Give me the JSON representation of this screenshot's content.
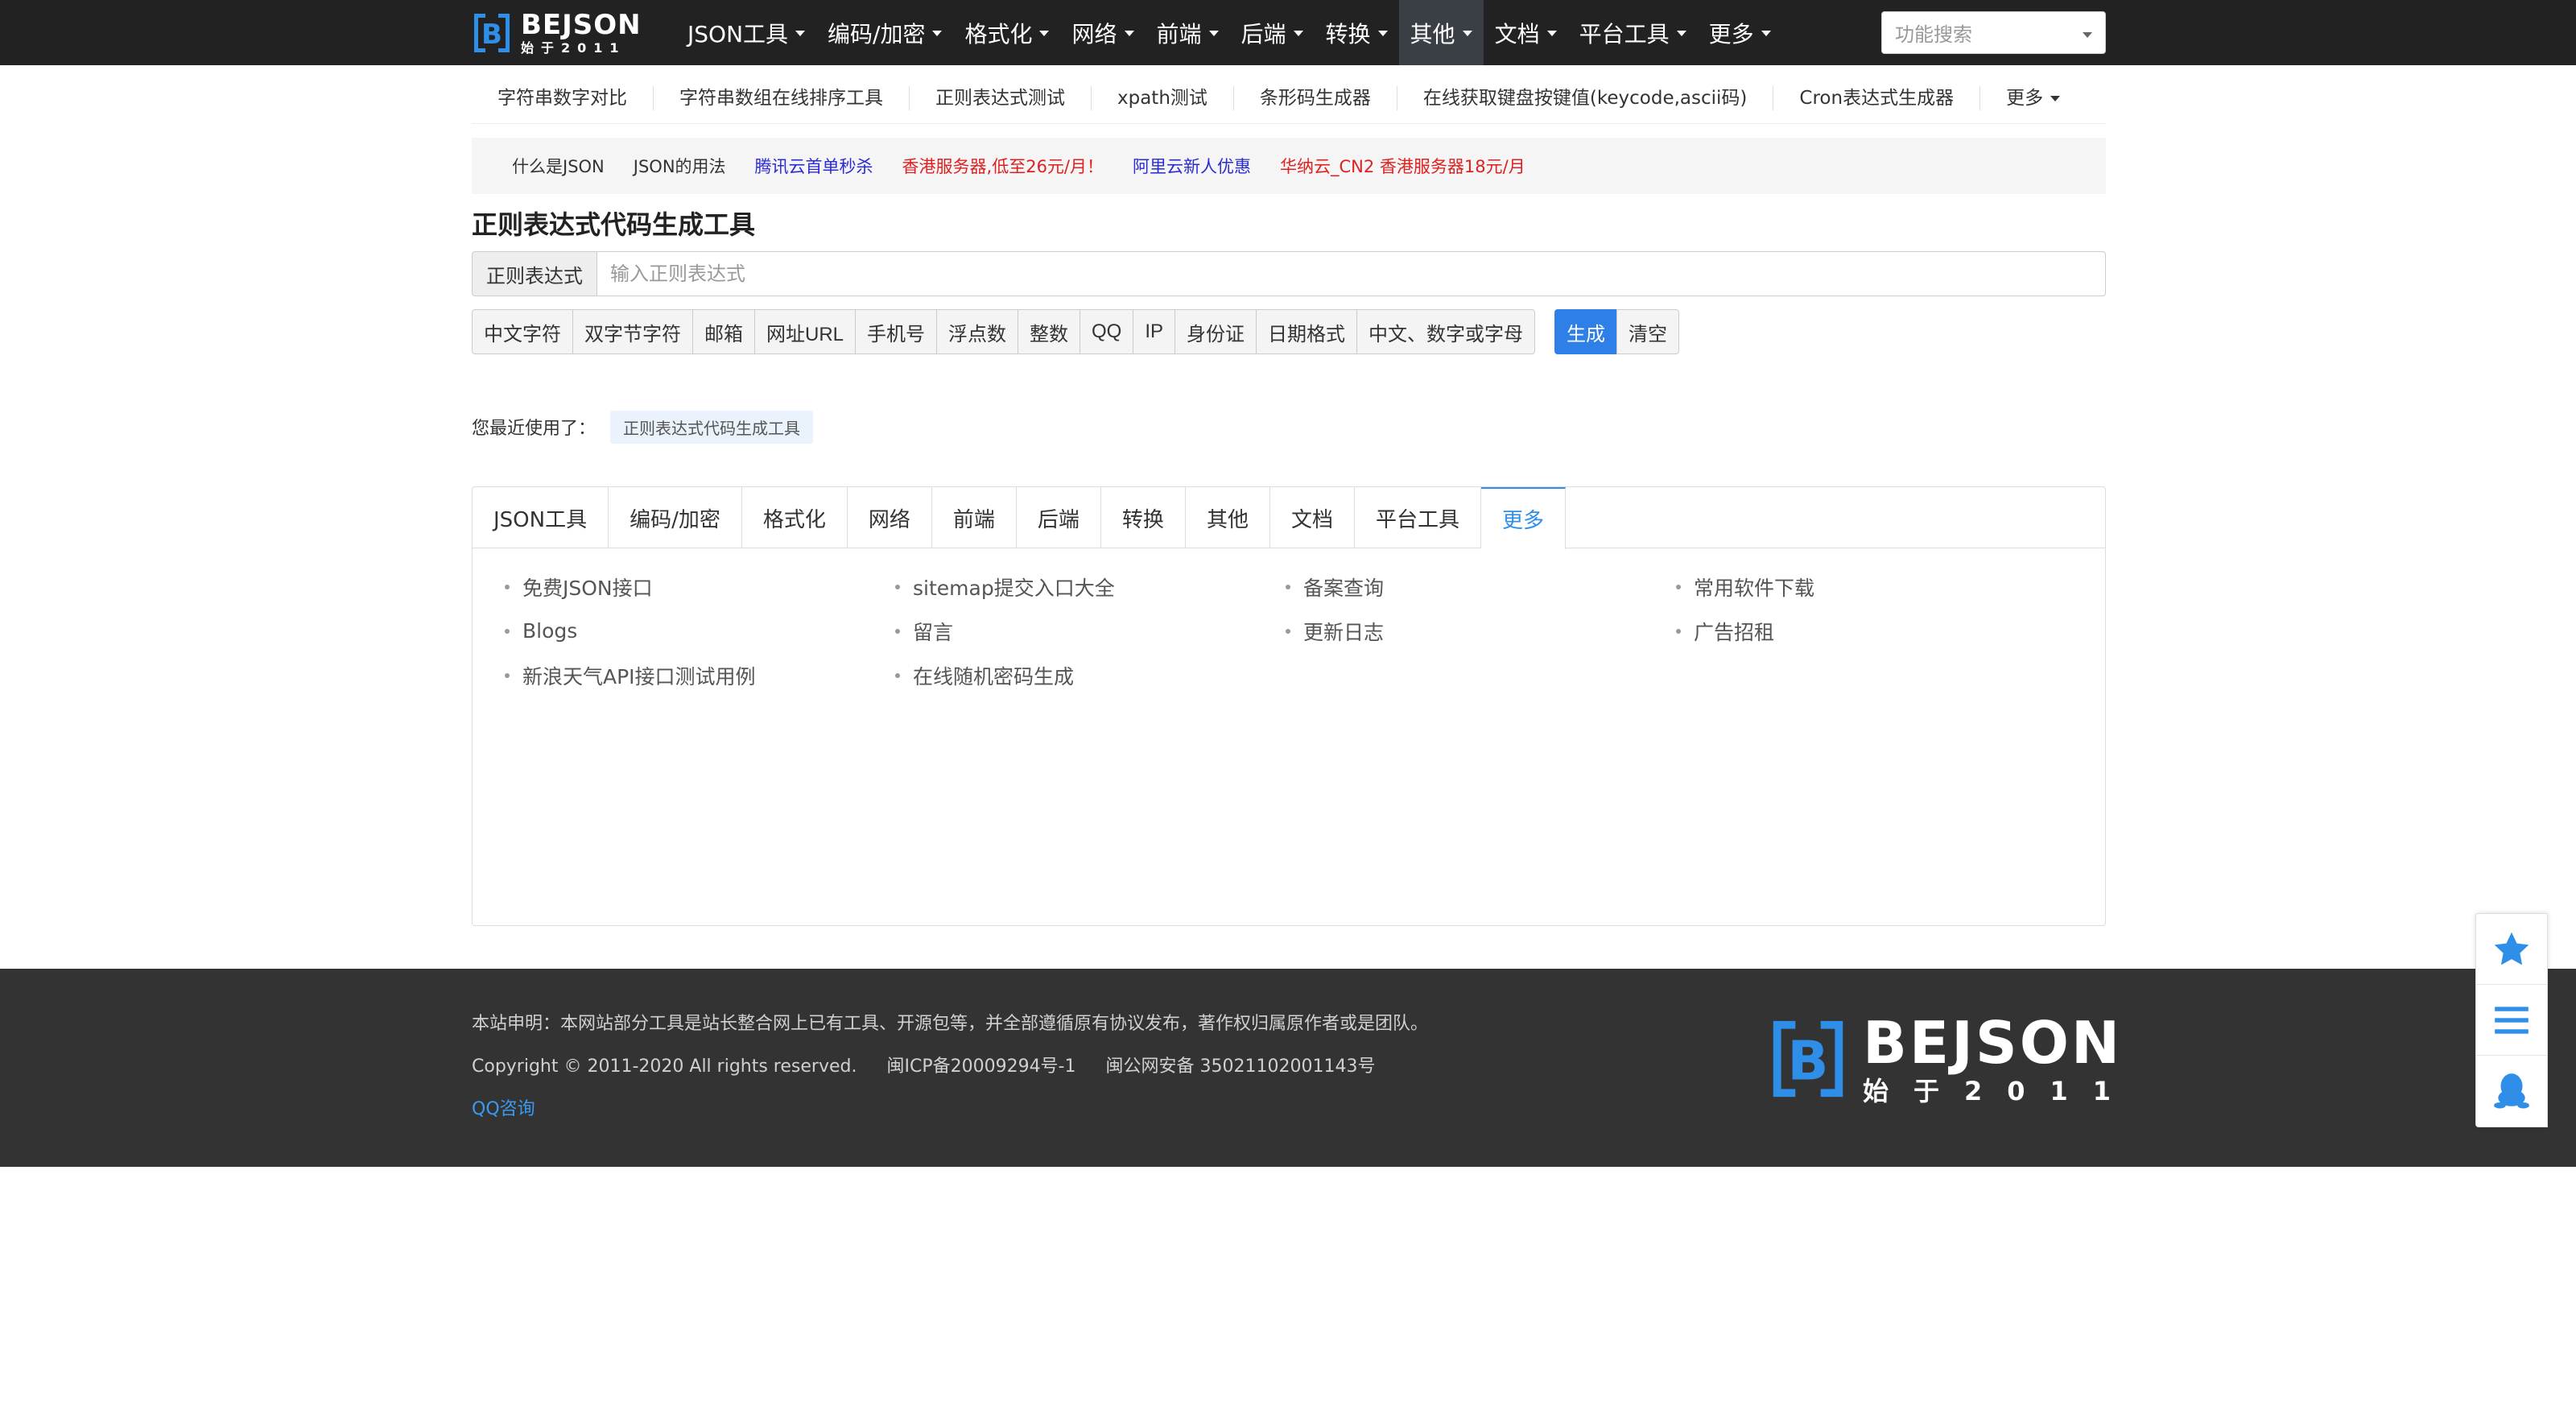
{
  "brand": {
    "name": "BEJSON",
    "slogan": "始于2011",
    "color": "#2f8fe8"
  },
  "nav": {
    "items": [
      {
        "label": "JSON工具",
        "active": false
      },
      {
        "label": "编码/加密",
        "active": false
      },
      {
        "label": "格式化",
        "active": false
      },
      {
        "label": "网络",
        "active": false
      },
      {
        "label": "前端",
        "active": false
      },
      {
        "label": "后端",
        "active": false
      },
      {
        "label": "转换",
        "active": false
      },
      {
        "label": "其他",
        "active": true
      },
      {
        "label": "文档",
        "active": false
      },
      {
        "label": "平台工具",
        "active": false
      },
      {
        "label": "更多",
        "active": false
      }
    ],
    "search_placeholder": "功能搜索"
  },
  "subnav": {
    "items": [
      "字符串数字对比",
      "字符串数组在线排序工具",
      "正则表达式测试",
      "xpath测试",
      "条形码生成器",
      "在线获取键盘按键值(keycode,ascii码)",
      "Cron表达式生成器"
    ],
    "more": "更多"
  },
  "promo": {
    "links": [
      {
        "text": "什么是JSON",
        "color": "#333333"
      },
      {
        "text": "JSON的用法",
        "color": "#333333"
      },
      {
        "text": "腾讯云首单秒杀",
        "color": "#2b2bd6"
      },
      {
        "text": "香港服务器,低至26元/月！",
        "color": "#e02020"
      },
      {
        "text": "阿里云新人优惠",
        "color": "#2b2bd6"
      },
      {
        "text": "华纳云_CN2 香港服务器18元/月",
        "color": "#e02020"
      }
    ]
  },
  "page": {
    "title": "正则表达式代码生成工具"
  },
  "regex": {
    "addon": "正则表达式",
    "placeholder": "输入正则表达式",
    "value": ""
  },
  "presets": [
    "中文字符",
    "双字节字符",
    "邮箱",
    "网址URL",
    "手机号",
    "浮点数",
    "整数",
    "QQ",
    "IP",
    "身份证",
    "日期格式",
    "中文、数字或字母"
  ],
  "actions": {
    "generate": "生成",
    "clear": "清空"
  },
  "recent": {
    "label": "您最近使用了：",
    "items": [
      "正则表达式代码生成工具"
    ]
  },
  "tabs": {
    "items": [
      "JSON工具",
      "编码/加密",
      "格式化",
      "网络",
      "前端",
      "后端",
      "转换",
      "其他",
      "文档",
      "平台工具",
      "更多"
    ],
    "active": "更多",
    "links": [
      "免费JSON接口",
      "sitemap提交入口大全",
      "备案查询",
      "常用软件下载",
      "Blogs",
      "留言",
      "更新日志",
      "广告招租",
      "新浪天气API接口测试用例",
      "在线随机密码生成"
    ]
  },
  "footer": {
    "statement": "本站申明：本网站部分工具是站长整合网上已有工具、开源包等，并全部遵循原有协议发布，著作权归属原作者或是团队。",
    "copyright": "Copyright © 2011-2020 All rights reserved.",
    "icp": "闽ICP备20009294号-1",
    "police": "闽公网安备 35021102001143号",
    "qq": "QQ咨询"
  },
  "side": {
    "icons": [
      "star-icon",
      "menu-icon",
      "qq-icon"
    ],
    "accent": "#2f8fe8"
  }
}
